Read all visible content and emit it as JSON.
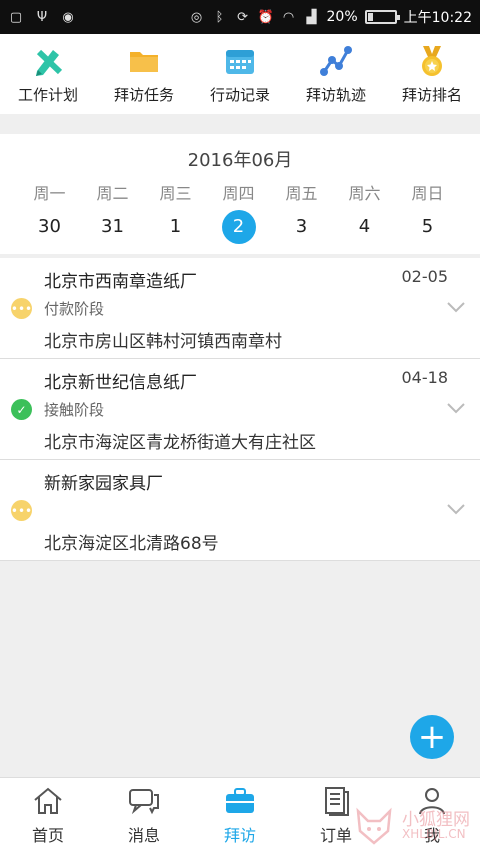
{
  "status_bar": {
    "battery": "20%",
    "time": "上午10:22",
    "battery_level": 0.2,
    "icons": [
      "screenshot-icon",
      "usb-icon",
      "android-icon",
      "location-icon",
      "bluetooth-icon",
      "rotate-icon",
      "alarm-icon",
      "wifi-icon",
      "signal-icon",
      "battery-icon"
    ]
  },
  "toolbar": {
    "items": [
      {
        "label": "工作计划",
        "icon": "pencil-ruler-icon"
      },
      {
        "label": "拜访任务",
        "icon": "folder-icon"
      },
      {
        "label": "行动记录",
        "icon": "calendar-icon"
      },
      {
        "label": "拜访轨迹",
        "icon": "route-icon"
      },
      {
        "label": "拜访排名",
        "icon": "medal-icon"
      }
    ]
  },
  "calendar": {
    "month": "2016年06月",
    "days": [
      {
        "name": "周一",
        "day": "30"
      },
      {
        "name": "周二",
        "day": "31"
      },
      {
        "name": "周三",
        "day": "1"
      },
      {
        "name": "周四",
        "day": "2"
      },
      {
        "name": "周五",
        "day": "3"
      },
      {
        "name": "周六",
        "day": "4"
      },
      {
        "name": "周日",
        "day": "5"
      }
    ],
    "selected_index": 3,
    "accent": "#1ea7e8"
  },
  "visits": [
    {
      "name": "北京市西南章造纸厂",
      "date": "02-05",
      "stage": "付款阶段",
      "address": "北京市房山区韩村河镇西南章村",
      "status_icon": "more-dots-icon",
      "status_color": "#f7d36b"
    },
    {
      "name": "北京新世纪信息纸厂",
      "date": "04-18",
      "stage": "接触阶段",
      "address": "北京市海淀区青龙桥街道大有庄社区",
      "status_icon": "check-icon",
      "status_color": "#3cc05a"
    },
    {
      "name": "新新家园家具厂",
      "date": "",
      "stage": "",
      "address": "北京海淀区北清路68号",
      "status_icon": "more-dots-icon",
      "status_color": "#f7d36b"
    }
  ],
  "fab": {
    "label": "+"
  },
  "tabs": [
    {
      "label": "首页",
      "icon": "home-icon"
    },
    {
      "label": "消息",
      "icon": "chat-icon"
    },
    {
      "label": "拜访",
      "icon": "briefcase-icon"
    },
    {
      "label": "订单",
      "icon": "document-icon"
    },
    {
      "label": "我",
      "icon": "person-icon"
    }
  ],
  "active_tab": 2,
  "watermark": {
    "text": "小狐狸网",
    "sub": "XHLBJL.CN"
  }
}
